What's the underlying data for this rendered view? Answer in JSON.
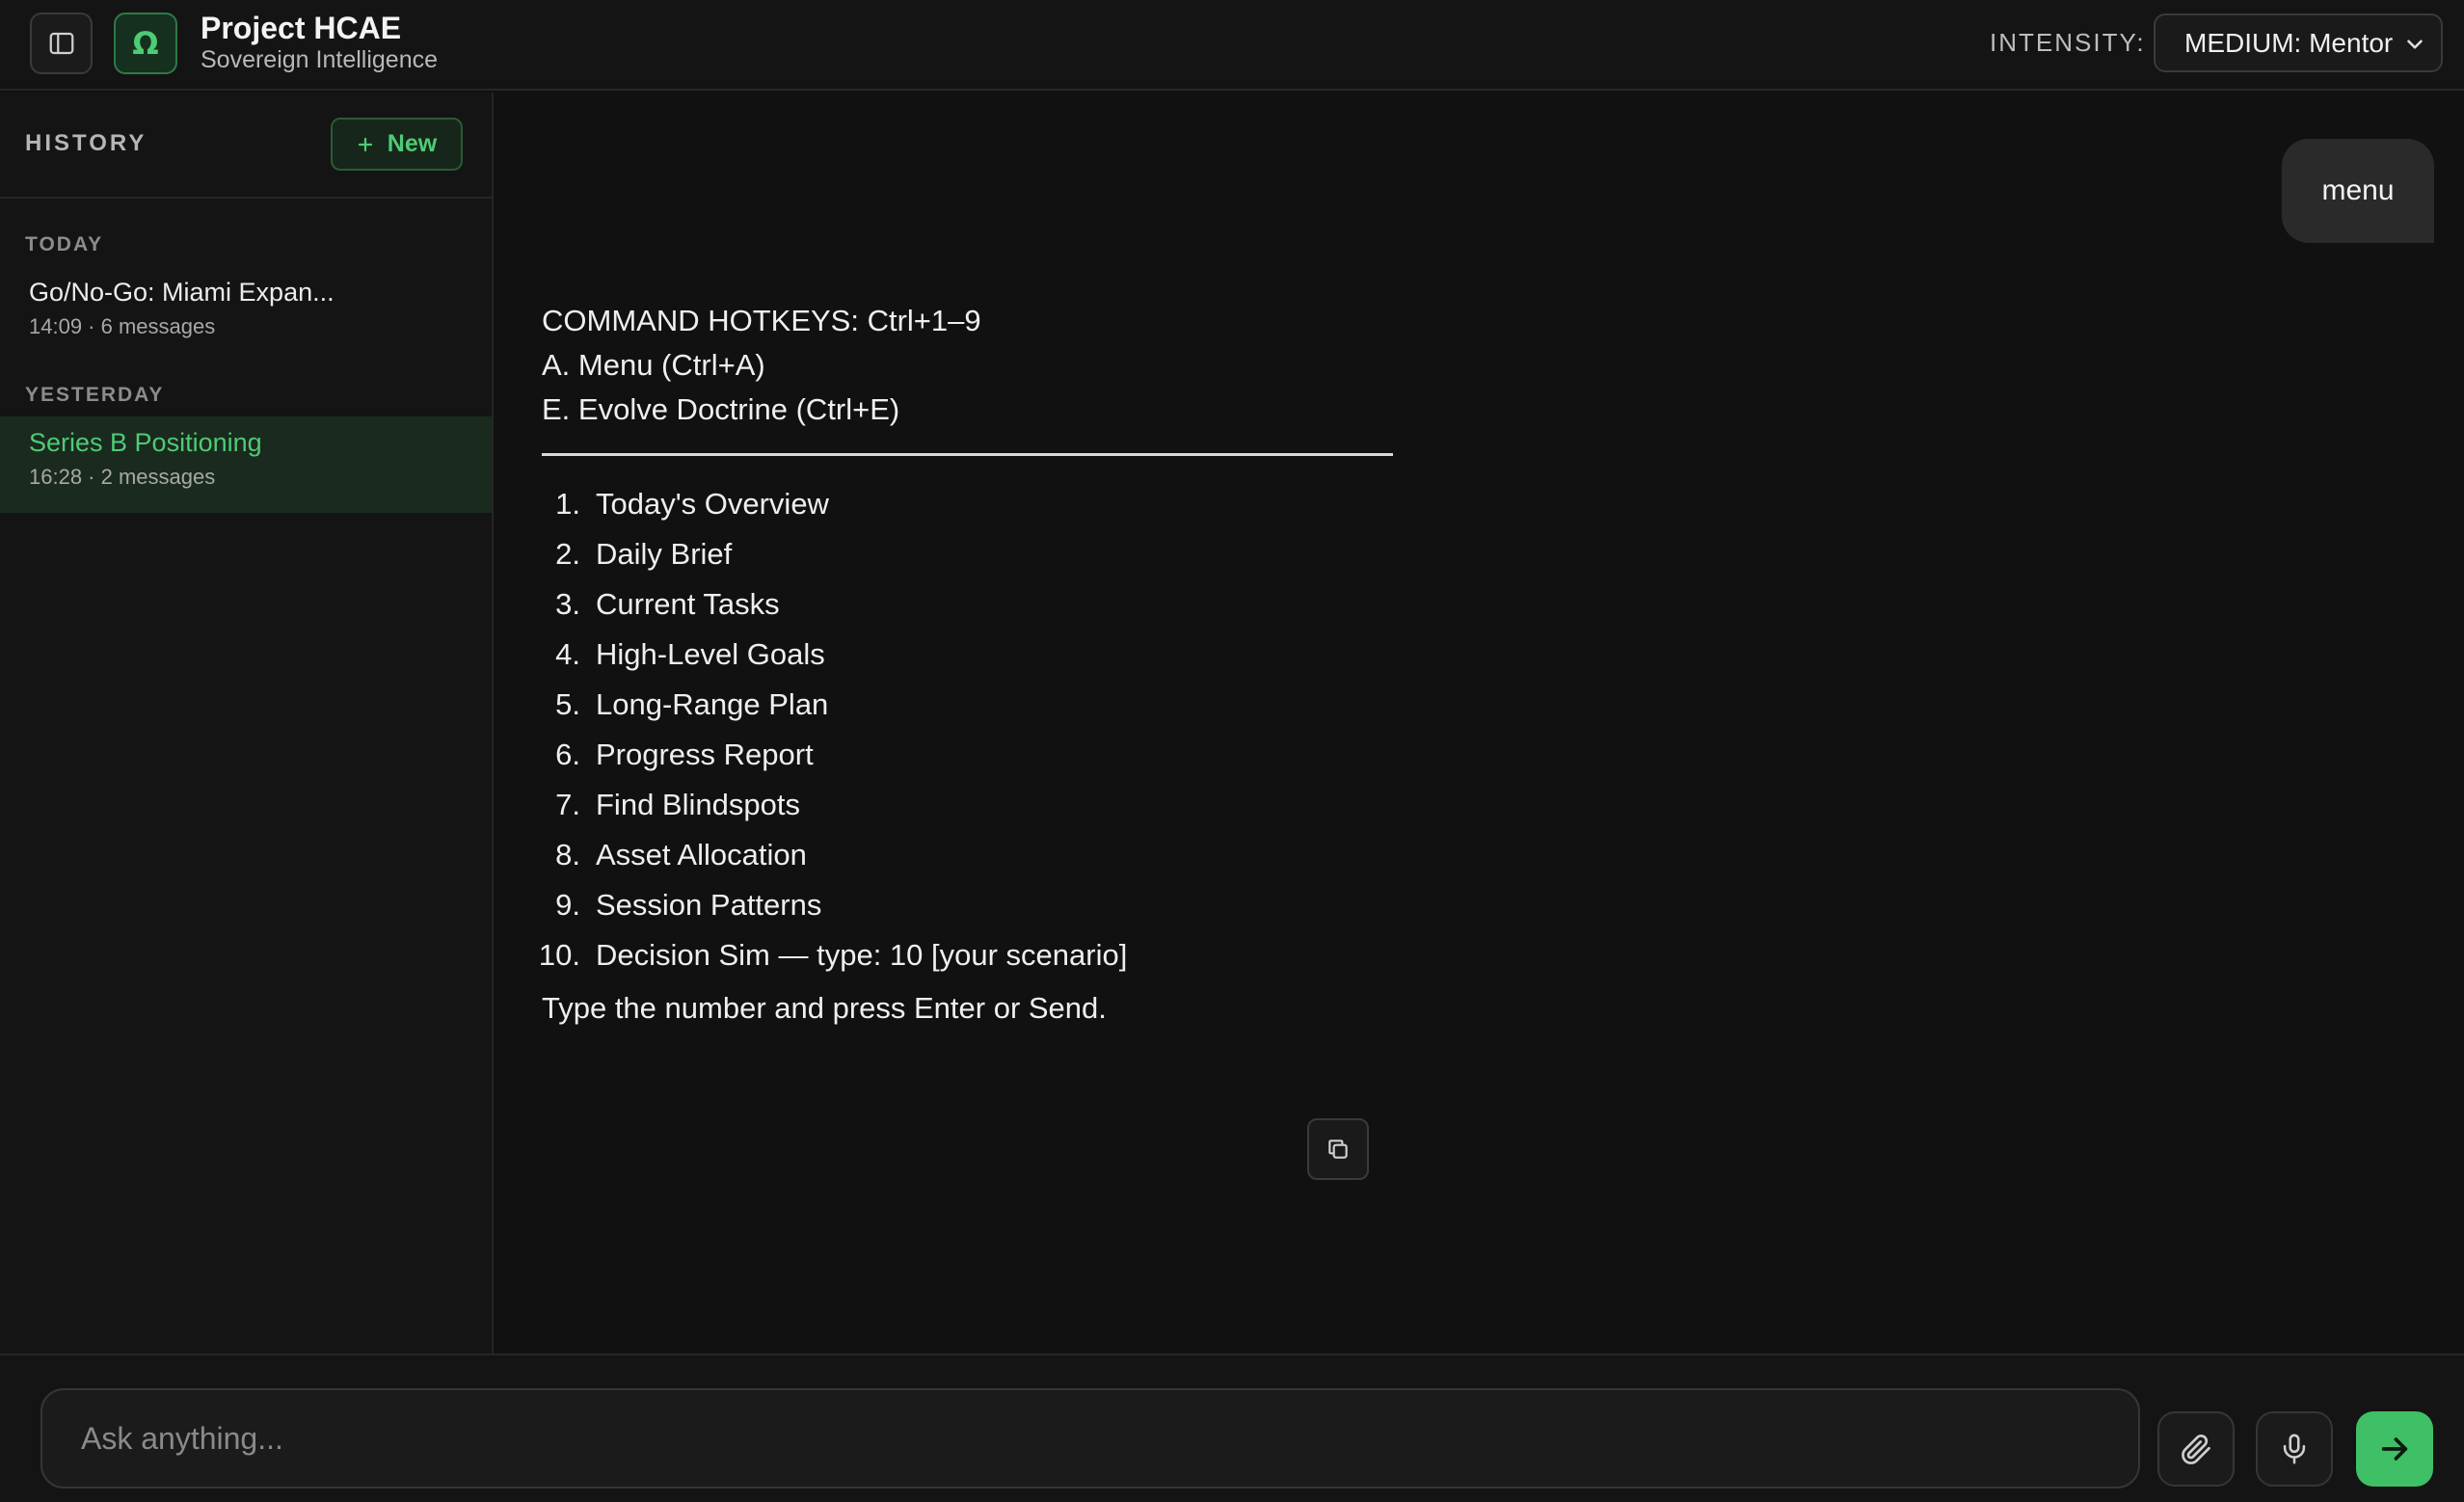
{
  "header": {
    "title": "Project HCAE",
    "subtitle": "Sovereign Intelligence",
    "logo_glyph": "Ω",
    "intensity_label": "INTENSITY:",
    "intensity_value": "MEDIUM: Mentor"
  },
  "sidebar": {
    "history_label": "HISTORY",
    "new_label": "New",
    "groups": [
      {
        "label": "TODAY",
        "items": [
          {
            "title": "Go/No-Go: Miami Expan...",
            "meta": "14:09 · 6 messages",
            "active": false
          }
        ]
      },
      {
        "label": "YESTERDAY",
        "items": [
          {
            "title": "Series B Positioning",
            "meta": "16:28 · 2 messages",
            "active": true
          }
        ]
      }
    ]
  },
  "chat": {
    "user_message": "menu",
    "reply": {
      "header_lines": [
        "COMMAND HOTKEYS: Ctrl+1–9",
        "A. Menu (Ctrl+A)",
        "E. Evolve Doctrine (Ctrl+E)"
      ],
      "items": [
        {
          "num": "1.",
          "text": "Today's Overview"
        },
        {
          "num": "2.",
          "text": "Daily Brief"
        },
        {
          "num": "3.",
          "text": "Current Tasks"
        },
        {
          "num": "4.",
          "text": "High-Level Goals"
        },
        {
          "num": "5.",
          "text": "Long-Range Plan"
        },
        {
          "num": "6.",
          "text": "Progress Report"
        },
        {
          "num": "7.",
          "text": "Find Blindspots"
        },
        {
          "num": "8.",
          "text": "Asset Allocation"
        },
        {
          "num": "9.",
          "text": "Session Patterns"
        },
        {
          "num": "10.",
          "text": "Decision Sim — type: 10 [your scenario]"
        }
      ],
      "footer": "Type the number and press Enter or Send."
    }
  },
  "composer": {
    "placeholder": "Ask anything...",
    "value": ""
  },
  "colors": {
    "accent": "#4ecb75",
    "send_button": "#3fbf66",
    "background": "#111111",
    "panel": "#141414"
  },
  "icons": {
    "sidebar_toggle": "sidebar-toggle-icon",
    "logo": "omega-logo-icon",
    "new": "plus-icon",
    "dropdown": "chevron-down-icon",
    "copy": "copy-icon",
    "attach": "paperclip-icon",
    "mic": "microphone-icon",
    "send": "arrow-right-icon"
  }
}
